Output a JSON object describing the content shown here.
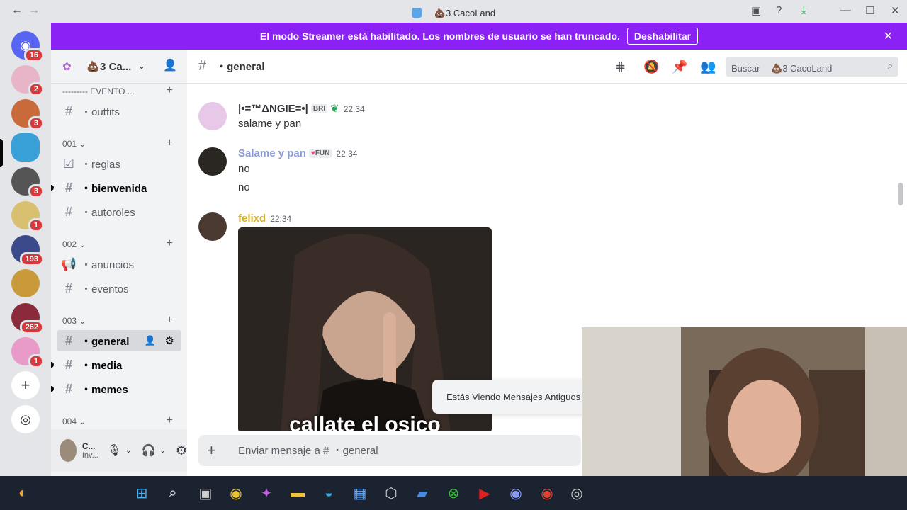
{
  "window": {
    "title": "ﾠ💩3 CacoLand",
    "back": "←",
    "forward": "→"
  },
  "banner": {
    "text": "El modo Streamer está habilitado. Los nombres de usuario se han truncado.",
    "button": "Deshabilitar",
    "close": "✕"
  },
  "servers": [
    {
      "badge": "16",
      "color": "#5865f2"
    },
    {
      "badge": "2",
      "color": "#e8b4c8"
    },
    {
      "badge": "3",
      "color": "#c86a3a"
    },
    {
      "badge": "",
      "color": "#3aa0d8"
    },
    {
      "badge": "3",
      "color": "#555555"
    },
    {
      "badge": "1",
      "color": "#d8c070"
    },
    {
      "badge": "193",
      "color": "#3a4a8a"
    },
    {
      "badge": "",
      "color": "#c89a3a"
    },
    {
      "badge": "262",
      "color": "#8a2a3a"
    },
    {
      "badge": "1",
      "color": "#e89ac8"
    }
  ],
  "server": {
    "name": "ﾠ💩3 Ca..."
  },
  "channels": {
    "top": "--------- Evento ...",
    "outfits": "・outfits",
    "cat1": "001",
    "reglas": "・reglas",
    "bienvenida": "・bienvenida",
    "autoroles": "・autoroles",
    "cat2": "002",
    "anuncios": "・anuncios",
    "eventos": "・eventos",
    "cat3": "003",
    "general": "・general",
    "media": "・media",
    "memes": "・memes",
    "cat4": "004"
  },
  "user": {
    "name": "C...",
    "status": "Inv..."
  },
  "chat": {
    "channel": "・general",
    "search": "Buscar ﾠ💩3 CacoLand"
  },
  "messages": [
    {
      "user": "|•=™ΔNGIE=•|",
      "tag": "BRI",
      "time": "22:34",
      "lines": [
        "salame y pan"
      ],
      "color": "#313338"
    },
    {
      "user": "Salame y pan",
      "tag": "FUN",
      "time": "22:34",
      "lines": [
        "no",
        "no"
      ],
      "color": "#8a9bd8"
    },
    {
      "user": "felixd",
      "tag": "",
      "time": "22:34",
      "lines": [],
      "color": "#d4b02a"
    }
  ],
  "gif_caption": "callate el osico",
  "old_messages": "Estás Viendo Mensajes Antiguos",
  "composer": {
    "placeholder": "Enviar mensaje a # ・general"
  }
}
